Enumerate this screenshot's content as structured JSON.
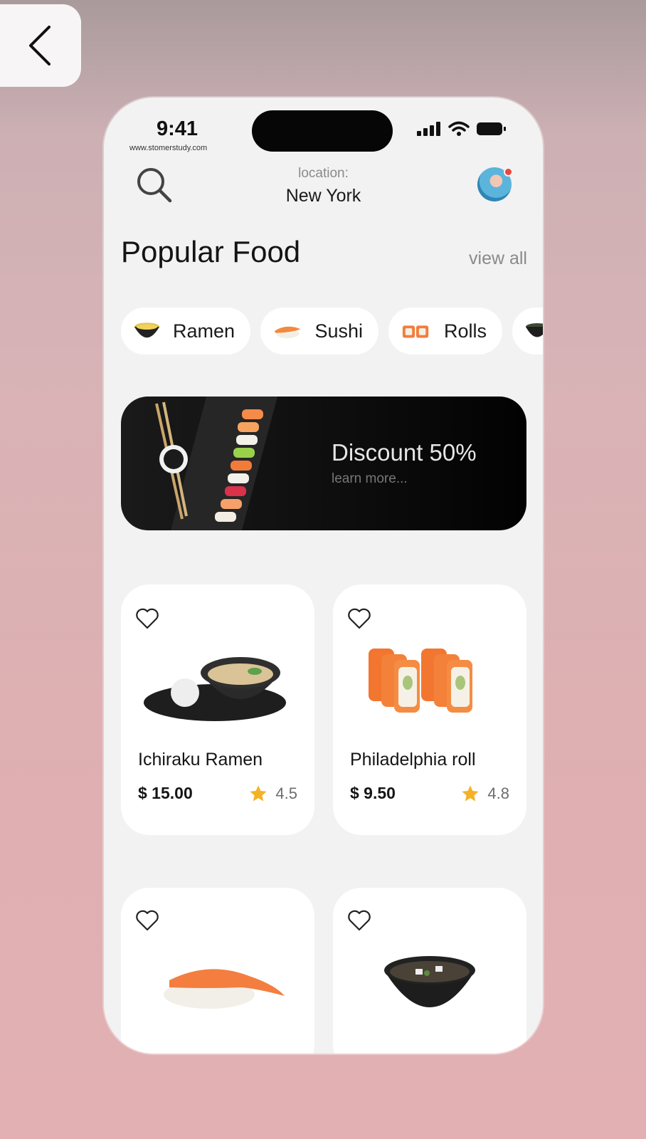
{
  "status_bar": {
    "time": "9:41",
    "watermark": "www.stomerstudy.com"
  },
  "header": {
    "location_label": "location:",
    "location_value": "New York"
  },
  "section": {
    "title": "Popular Food",
    "view_all": "view all"
  },
  "categories": [
    {
      "label": "Ramen",
      "icon": "ramen-bowl-icon"
    },
    {
      "label": "Sushi",
      "icon": "nigiri-icon"
    },
    {
      "label": "Rolls",
      "icon": "roll-icon"
    },
    {
      "label": "",
      "icon": "soup-bowl-icon"
    }
  ],
  "banner": {
    "title": "Discount 50%",
    "subtitle": "learn more..."
  },
  "foods": [
    {
      "name": "Ichiraku Ramen",
      "price": "$ 15.00",
      "rating": "4.5"
    },
    {
      "name": "Philadelphia roll",
      "price": "$ 9.50",
      "rating": "4.8"
    },
    {
      "name": "",
      "price": "",
      "rating": ""
    },
    {
      "name": "",
      "price": "",
      "rating": ""
    }
  ],
  "colors": {
    "star": "#f5b125",
    "background": "#dfb0b2",
    "phone": "#f2f2f2",
    "card": "#ffffff"
  }
}
